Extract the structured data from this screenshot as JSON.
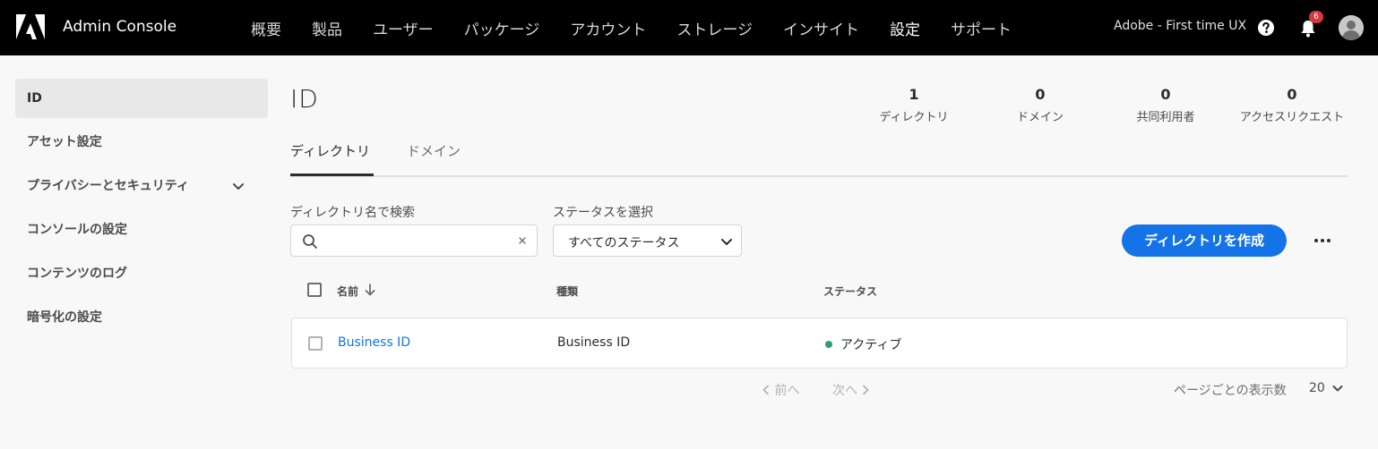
{
  "header": {
    "app_title": "Admin Console",
    "logo_icon": "adobe-logo",
    "nav": [
      {
        "label": "概要",
        "active": false
      },
      {
        "label": "製品",
        "active": false
      },
      {
        "label": "ユーザー",
        "active": false
      },
      {
        "label": "パッケージ",
        "active": false
      },
      {
        "label": "アカウント",
        "active": false
      },
      {
        "label": "ストレージ",
        "active": false
      },
      {
        "label": "インサイト",
        "active": false
      },
      {
        "label": "設定",
        "active": true
      },
      {
        "label": "サポート",
        "active": false
      }
    ],
    "org_name": "Adobe - First time UX",
    "notification_count": "6",
    "icons": {
      "help": "help-icon",
      "notifications": "bell-icon",
      "profile": "avatar"
    }
  },
  "sidebar": {
    "items": [
      {
        "label": "ID",
        "active": true
      },
      {
        "label": "アセット設定",
        "active": false
      },
      {
        "label": "プライバシーとセキュリティ",
        "active": false,
        "has_chevron": true
      },
      {
        "label": "コンソールの設定",
        "active": false
      },
      {
        "label": "コンテンツのログ",
        "active": false
      },
      {
        "label": "暗号化の設定",
        "active": false
      }
    ]
  },
  "main": {
    "title": "ID",
    "stats": [
      {
        "value": "1",
        "label": "ディレクトリ"
      },
      {
        "value": "0",
        "label": "ドメイン"
      },
      {
        "value": "0",
        "label": "共同利用者"
      },
      {
        "value": "0",
        "label": "アクセスリクエスト"
      }
    ],
    "tabs": [
      {
        "label": "ディレクトリ",
        "active": true
      },
      {
        "label": "ドメイン",
        "active": false
      }
    ],
    "search": {
      "label": "ディレクトリ名で検索",
      "value": "",
      "placeholder": ""
    },
    "status_filter": {
      "label": "ステータスを選択",
      "value": "すべてのステータス"
    },
    "create_button": "ディレクトリを作成",
    "table": {
      "columns": [
        "名前",
        "種類",
        "ステータス"
      ],
      "sort": {
        "column": "名前",
        "direction": "descending"
      },
      "rows": [
        {
          "name": "Business ID",
          "type": "Business ID",
          "status": "アクティブ",
          "status_color": "#2d9d78"
        }
      ]
    },
    "pagination": {
      "prev": "前へ",
      "next": "次へ",
      "per_page_label": "ページごとの表示数",
      "per_page_value": "20"
    }
  },
  "colors": {
    "accent": "#1473e6",
    "topbar": "#000000",
    "active_status": "#2d9d78",
    "badge": "#d7373f"
  }
}
